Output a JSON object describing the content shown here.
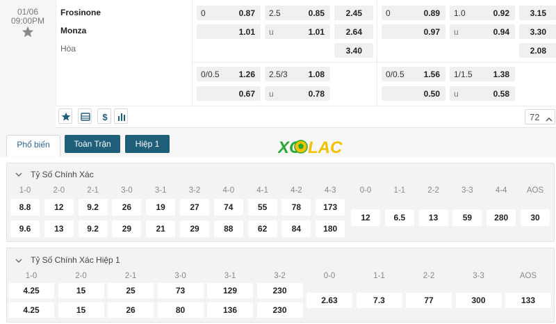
{
  "match": {
    "date": "01/06",
    "time": "09:00PM",
    "home": "Frosinone",
    "away": "Monza",
    "draw": "Hòa",
    "comments_count": "72",
    "ft": {
      "hdp_line": "0",
      "hdp_home": "0.87",
      "hdp_away": "1.01",
      "ou_line": "2.5",
      "ou_over": "0.85",
      "ou_under_label": "u",
      "ou_under": "1.01",
      "x12_home": "2.45",
      "x12_away": "2.64",
      "x12_draw": "3.40",
      "hdp2_line": "0/0.5",
      "hdp2_home": "1.26",
      "hdp2_away": "0.67",
      "ou2_line": "2.5/3",
      "ou2_over": "1.08",
      "ou2_under_label": "u",
      "ou2_under": "0.78"
    },
    "h1": {
      "hdp_line": "0",
      "hdp_home": "0.89",
      "hdp_away": "0.97",
      "ou_line": "1.0",
      "ou_over": "0.92",
      "ou_under_label": "u",
      "ou_under": "0.94",
      "x12_home": "3.15",
      "x12_away": "3.30",
      "x12_draw": "2.08",
      "hdp2_line": "0/0.5",
      "hdp2_home": "1.56",
      "hdp2_away": "0.50",
      "ou2_line": "1/1.5",
      "ou2_over": "1.38",
      "ou2_under_label": "u",
      "ou2_under": "0.58"
    },
    "icons": [
      "star-icon",
      "list-icon",
      "dollar-icon",
      "chart-icon",
      "chevron-up-icon"
    ]
  },
  "tabs": {
    "popular": "Phổ biến",
    "full_match": "Toàn Trận",
    "half1": "Hiệp 1"
  },
  "logo_text": "XOILAC",
  "colors": {
    "tab_button": "#1f5f7a",
    "logo_green": "#2aa832",
    "logo_yellow": "#f2c200"
  },
  "correct_score": {
    "title": "Tỷ Số Chính Xác",
    "home_labels": [
      "1-0",
      "2-0",
      "2-1",
      "3-0",
      "3-1",
      "3-2",
      "4-0",
      "4-1",
      "4-2",
      "4-3"
    ],
    "home_values": [
      "8.8",
      "12",
      "9.2",
      "26",
      "19",
      "27",
      "74",
      "55",
      "78",
      "173"
    ],
    "away_values": [
      "9.6",
      "13",
      "9.2",
      "29",
      "21",
      "29",
      "88",
      "62",
      "84",
      "180"
    ],
    "draw_labels": [
      "0-0",
      "1-1",
      "2-2",
      "3-3",
      "4-4",
      "AOS"
    ],
    "draw_values": [
      "12",
      "6.5",
      "13",
      "59",
      "280",
      "30"
    ]
  },
  "correct_score_h1": {
    "title": "Tỷ Số Chính Xác Hiệp 1",
    "home_labels": [
      "1-0",
      "2-0",
      "2-1",
      "3-0",
      "3-1",
      "3-2"
    ],
    "home_values": [
      "4.25",
      "15",
      "25",
      "73",
      "129",
      "230"
    ],
    "away_values": [
      "4.25",
      "15",
      "26",
      "80",
      "136",
      "230"
    ],
    "draw_labels": [
      "0-0",
      "1-1",
      "2-2",
      "3-3",
      "AOS"
    ],
    "draw_values": [
      "2.63",
      "7.3",
      "77",
      "300",
      "133"
    ]
  }
}
